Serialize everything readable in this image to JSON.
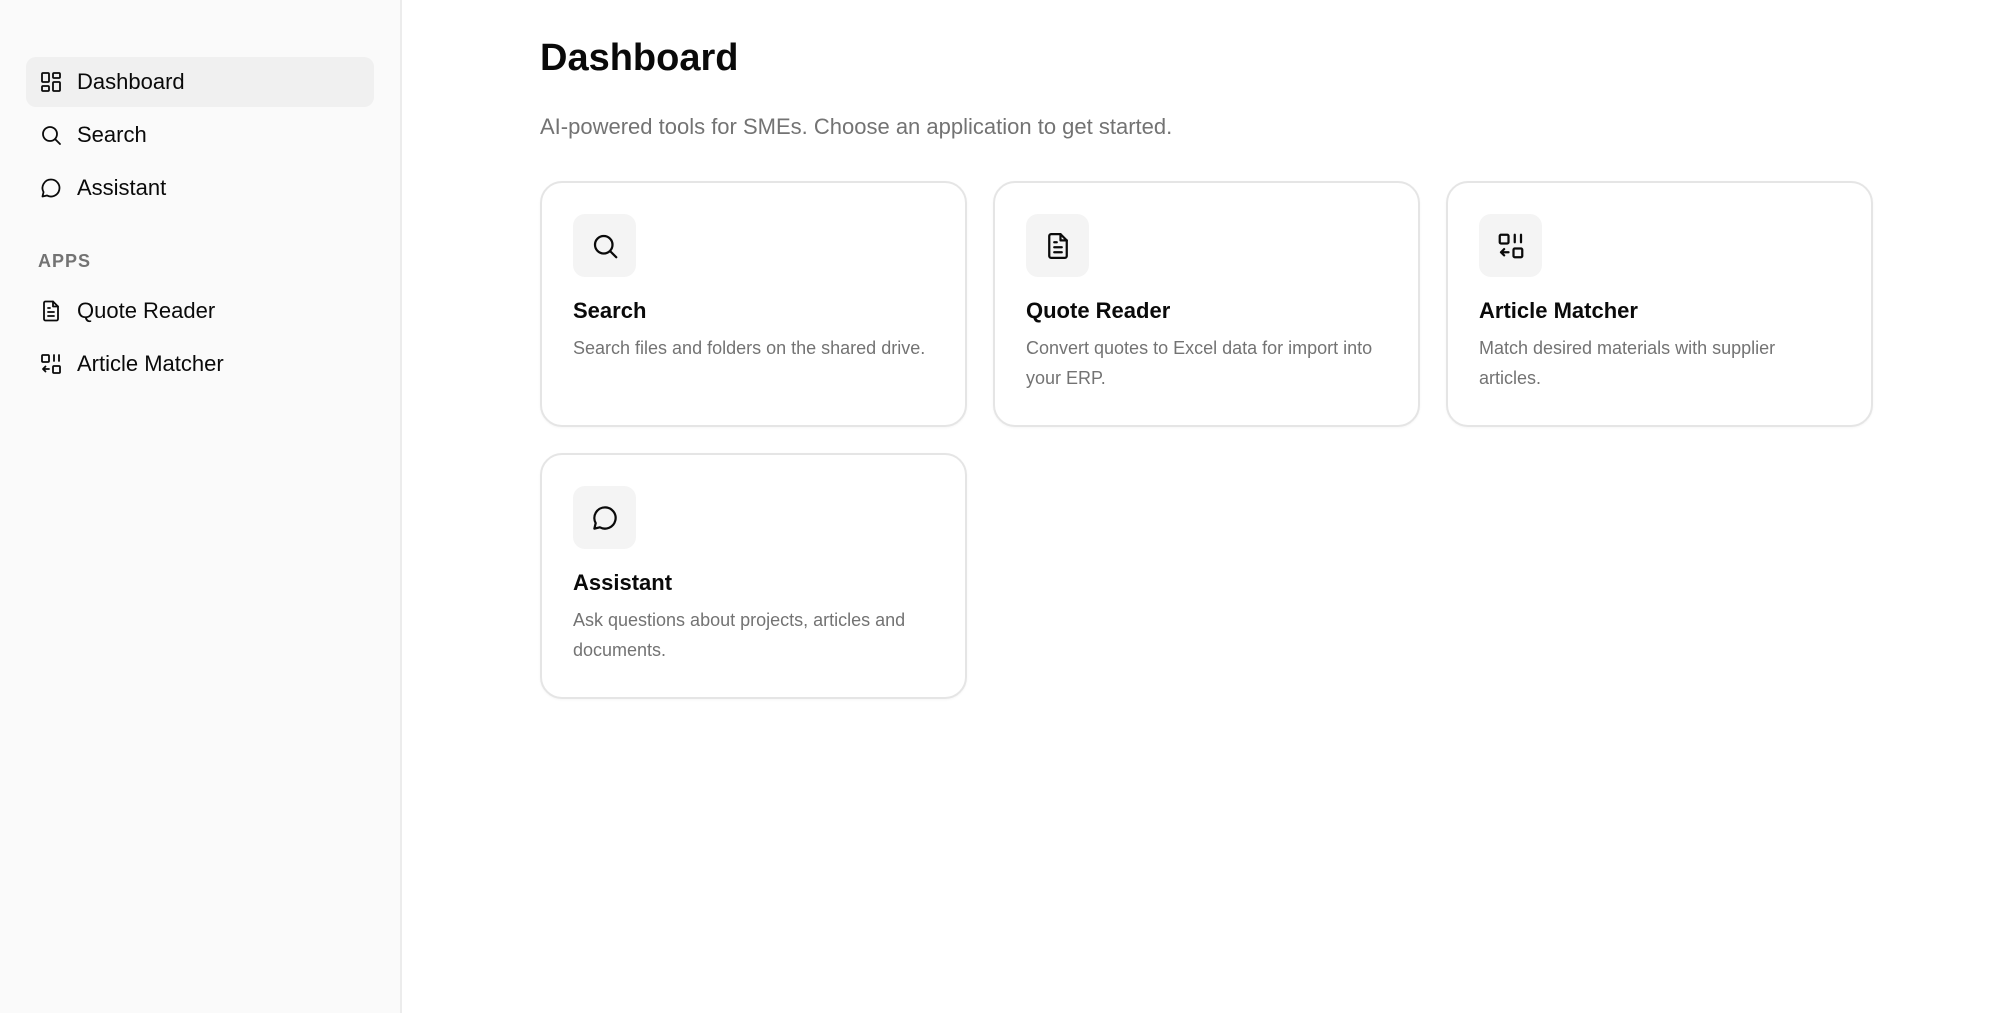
{
  "sidebar": {
    "items": [
      {
        "label": "Dashboard",
        "icon": "dashboard-icon",
        "active": true
      },
      {
        "label": "Search",
        "icon": "search-icon"
      },
      {
        "label": "Assistant",
        "icon": "chat-bubble-icon"
      }
    ],
    "apps_label": "APPS",
    "apps": [
      {
        "label": "Quote Reader",
        "icon": "document-icon"
      },
      {
        "label": "Article Matcher",
        "icon": "article-matcher-icon"
      }
    ]
  },
  "main": {
    "title": "Dashboard",
    "subtitle": "AI-powered tools for SMEs. Choose an application to get started.",
    "cards": [
      {
        "title": "Search",
        "description": "Search files and folders on the shared drive.",
        "icon": "search-icon"
      },
      {
        "title": "Quote Reader",
        "description": "Convert quotes to Excel data for import into your ERP.",
        "icon": "document-icon"
      },
      {
        "title": "Article Matcher",
        "description": "Match desired materials with supplier articles.",
        "icon": "article-matcher-icon"
      },
      {
        "title": "Assistant",
        "description": "Ask questions about projects, articles and documents.",
        "icon": "chat-bubble-icon"
      }
    ]
  },
  "colors": {
    "sidebar_bg": "#fafafa",
    "active_bg": "#f0f0f0",
    "muted_text": "#737373",
    "card_border": "#e5e5e5"
  }
}
